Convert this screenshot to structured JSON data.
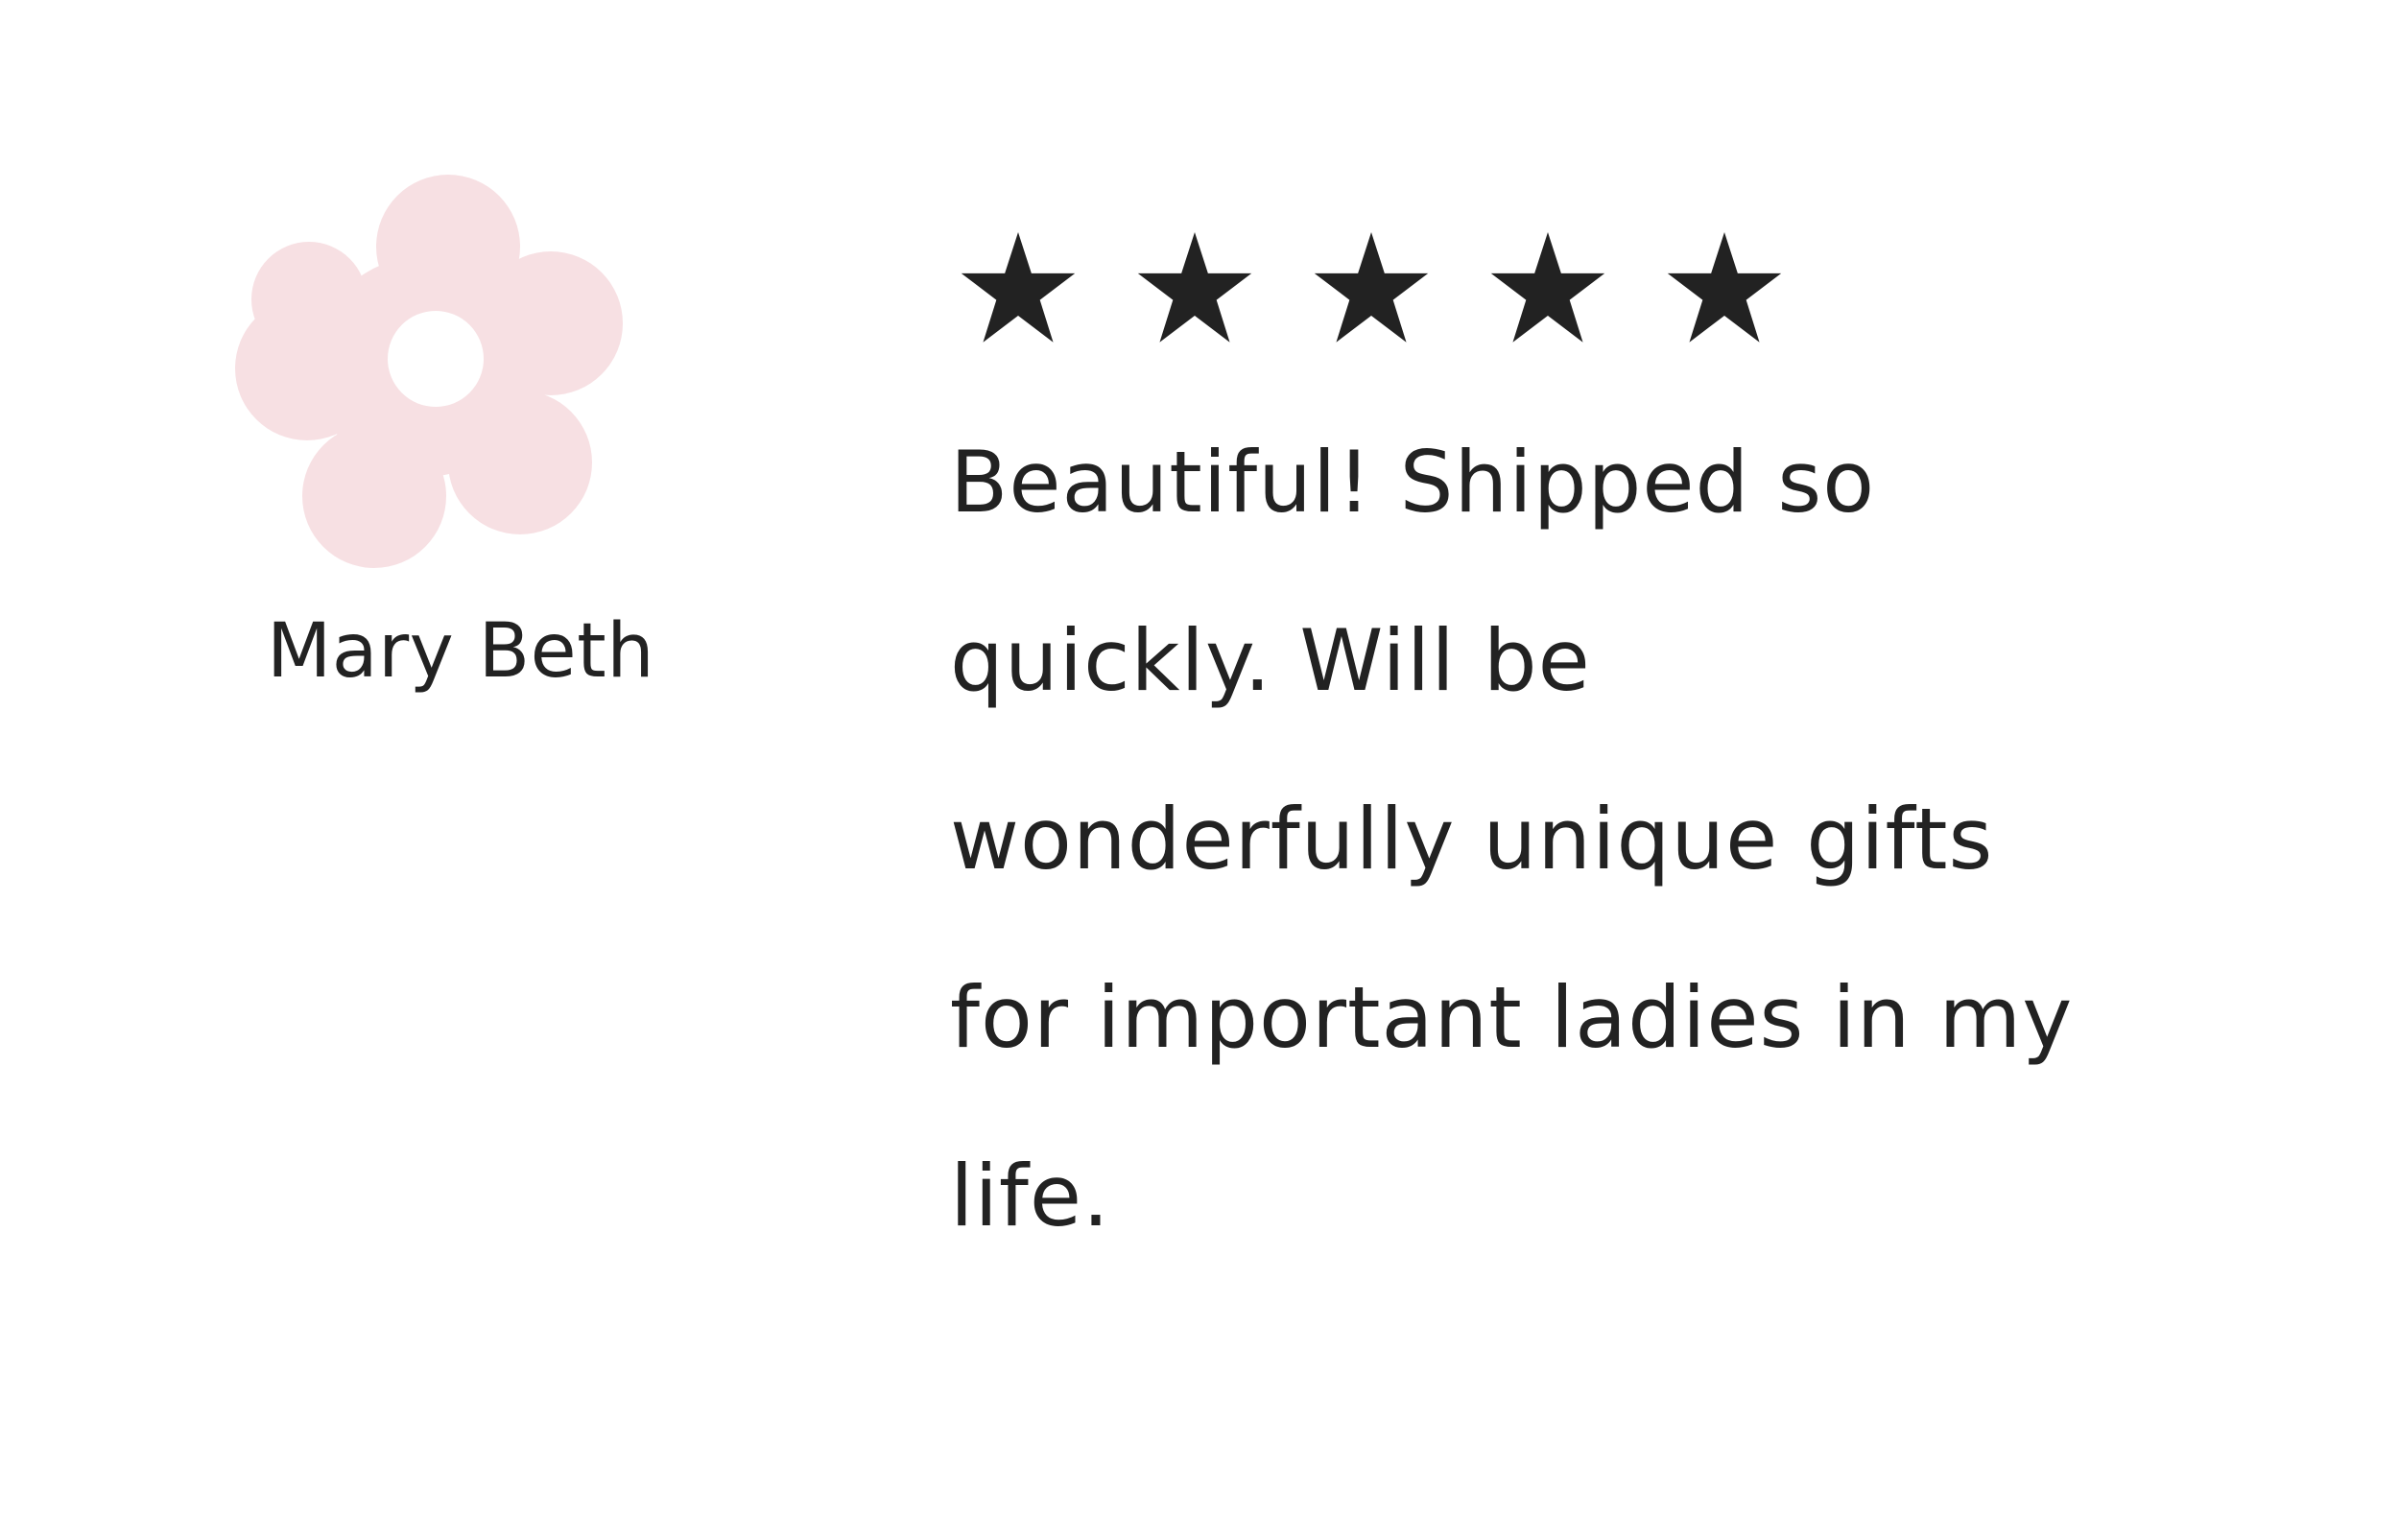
{
  "reviewer": {
    "name": "Mary Beth",
    "avatar_icon": "flower-icon",
    "avatar_color": "#f7e0e3"
  },
  "review": {
    "rating": 5,
    "rating_max": 5,
    "star_icon": "star-icon",
    "star_color": "#222222",
    "text_lines": [
      "Beautiful! Shipped so",
      "quickly. Will be",
      "wonderfully unique gifts",
      "for important ladies in my",
      "life."
    ]
  }
}
